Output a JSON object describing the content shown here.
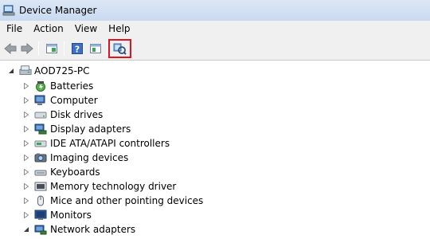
{
  "window": {
    "title": "Device Manager"
  },
  "menu": [
    "File",
    "Action",
    "View",
    "Help"
  ],
  "toolbar": {
    "buttons": [
      "back-arrow",
      "forward-arrow",
      "properties",
      "help",
      "update-driver",
      "scan-for-hardware-changes"
    ],
    "highlighted": "scan-for-hardware-changes"
  },
  "tree": {
    "root": "AOD725-PC",
    "categories": [
      "Batteries",
      "Computer",
      "Disk drives",
      "Display adapters",
      "IDE ATA/ATAPI controllers",
      "Imaging devices",
      "Keyboards",
      "Memory technology driver",
      "Mice and other pointing devices",
      "Monitors",
      "Network adapters"
    ],
    "icons": [
      "battery-icon",
      "computer-icon",
      "disk-drive-icon",
      "display-adapter-icon",
      "ide-controller-icon",
      "imaging-device-icon",
      "keyboard-icon",
      "memory-chip-icon",
      "mouse-icon",
      "monitor-icon",
      "network-adapter-icon"
    ],
    "expanded": "Network adapters"
  },
  "colors": {
    "highlight": "#e0141e",
    "titlebar": "#c9daf0",
    "chrome": "#f0f0f0"
  }
}
